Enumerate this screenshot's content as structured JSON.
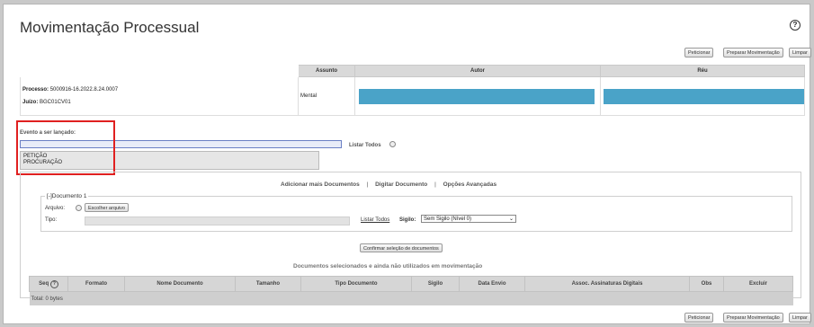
{
  "page": {
    "title": "Movimentação Processual"
  },
  "toolbar": {
    "buttons": [
      "Peticionar",
      "Preparar Movimentação",
      "Limpar"
    ]
  },
  "processo_table": {
    "headers": [
      "Assunto",
      "Autor",
      "Réu"
    ],
    "processo_label": "Processo:",
    "processo_value": "5000916-16.2022.8.24.0007",
    "juizo_label": "Juízo:",
    "juizo_value": "BGC01CV01",
    "assunto_value": "Mental",
    "redacted_color": "#4aa3c8"
  },
  "evento": {
    "label": "Evento a ser lançado:",
    "input_value": "",
    "listar_todos": "Listar Todos",
    "suggestions": [
      "PETIÇÃO",
      "PROCURAÇÃO"
    ],
    "highlight_color": "#e02020"
  },
  "documents": {
    "links": [
      "Adicionar mais Documentos",
      "Digitar Documento",
      "Opções Avançadas"
    ],
    "separator": "|",
    "fieldset_legend": "[-]Documento 1",
    "arquivo_label": "Arquivo:",
    "escolher_button": "Escolher arquivo",
    "tipo_label": "Tipo:",
    "tipo_listar": "Listar Todos",
    "sigilo_label": "Sigilo:",
    "sigilo_value": "Sem Sigilo (Nível 0)",
    "confirm_button": "Confirmar seleção de documentos",
    "section_title": "Documentos selecionados e ainda não utilizados em movimentação",
    "columns": [
      "Seq",
      "Formato",
      "Nome Documento",
      "Tamanho",
      "Tipo Documento",
      "Sigilo",
      "Data Envio",
      "Assoc. Assinaturas Digitais",
      "Obs",
      "Excluir"
    ],
    "total": "Total: 0 bytes"
  },
  "footer": {
    "buttons": [
      "Peticionar",
      "Preparar Movimentação",
      "Limpar"
    ]
  }
}
